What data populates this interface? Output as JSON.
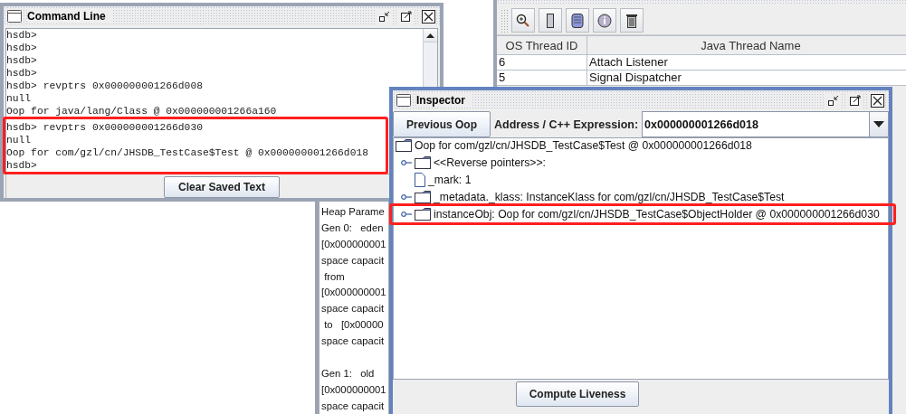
{
  "command_line": {
    "title": "Command Line",
    "lines": [
      "hsdb>",
      "hsdb>",
      "hsdb>",
      "hsdb>",
      "hsdb> revptrs 0x000000001266d008",
      "null",
      "Oop for java/lang/Class @ 0x000000001266a160",
      "hsdb> revptrs 0x000000001266d030",
      "null",
      "Oop for com/gzl/cn/JHSDB_TestCase$Test @ 0x000000001266d018",
      "hsdb>"
    ],
    "button": "Clear Saved Text"
  },
  "threads": {
    "columns": [
      "OS Thread ID",
      "Java Thread Name"
    ],
    "rows": [
      {
        "id": "6",
        "name": "Attach Listener"
      },
      {
        "id": "5",
        "name": "Signal Dispatcher"
      }
    ]
  },
  "heap_parameters": {
    "paragraphs": [
      [
        "Heap Parame",
        "Gen 0:   eden",
        "[0x000000001",
        "space capacit",
        " from",
        "[0x000000001",
        "space capacit",
        " to   [0x00000",
        "space capacit"
      ],
      [
        "Gen 1:   old",
        "[0x000000001",
        "space capacit"
      ]
    ]
  },
  "inspector": {
    "title": "Inspector",
    "previous_button": "Previous Oop",
    "address_label": "Address / C++ Expression:",
    "address_value": "0x000000001266d018",
    "tree": {
      "label": "Oop for com/gzl/cn/JHSDB_TestCase$Test @ 0x000000001266d018",
      "kind": "folder",
      "children": [
        {
          "label": "<<Reverse pointers>>:",
          "kind": "folder"
        },
        {
          "label": "_mark: 1",
          "kind": "file"
        },
        {
          "label": "_metadata._klass: InstanceKlass for com/gzl/cn/JHSDB_TestCase$Test",
          "kind": "folder"
        },
        {
          "label": "instanceObj: Oop for com/gzl/cn/JHSDB_TestCase$ObjectHolder @ 0x000000001266d030",
          "kind": "folder"
        }
      ]
    },
    "button": "Compute Liveness"
  }
}
